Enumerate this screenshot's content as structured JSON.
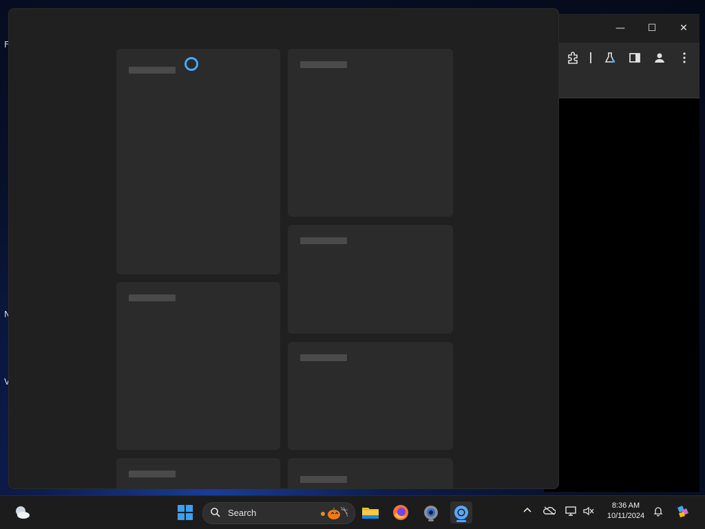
{
  "desktop": {
    "edge_letters": [
      "F",
      "N",
      "V"
    ]
  },
  "browser": {
    "minimize_label": "—",
    "maximize_label": "☐",
    "close_label": "✕",
    "toolbar_icons": [
      "extensions-icon",
      "labs-flask-icon",
      "side-panel-icon",
      "profile-icon",
      "more-menu-icon"
    ]
  },
  "panel": {
    "state": "loading",
    "accent": "#4aa8ff"
  },
  "taskbar": {
    "search_placeholder": "Search",
    "apps": [
      "widgets-icon",
      "start-icon",
      "file-explorer-icon",
      "firefox-icon",
      "settings-icon",
      "chrome-icon"
    ],
    "clock_time": "8:36 AM",
    "clock_date": "10/11/2024",
    "tray": [
      "chevron-up-icon",
      "onedrive-icon",
      "network-icon",
      "volume-muted-icon",
      "notification-bell-icon",
      "copilot-icon"
    ]
  }
}
